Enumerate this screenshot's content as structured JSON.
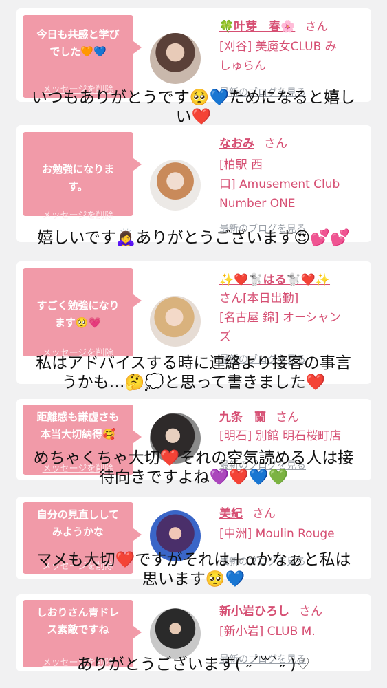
{
  "delete_label": "メッセージを削除",
  "blog_label": "最新のブログを見る",
  "honorific": "さん",
  "cards": [
    {
      "message": "今日も共感と学び\nでした🧡💙",
      "name": "🍀叶芽　春🌸",
      "shop": "[刈谷] 美魔女CLUB み\nしゅらん"
    },
    {
      "message": "お勉強になりま\nす。",
      "name": "なおみ",
      "shop": "[柏駅 西\n口] Amusement Club\nNumber ONE"
    },
    {
      "message": "すごく勉強になり\nます🥺💗",
      "name": "✨❤️🐩はる🐩❤️✨",
      "shop": "さん[本日出勤]\n[名古屋 錦] オーシャン\nズ"
    },
    {
      "message": "距離感も謙虚さも\n本当大切納得🥰",
      "name": "九条　蘭",
      "shop": "[明石] 別館 明石桜町店"
    },
    {
      "message": "自分の見直しして\nみようかな",
      "name": "美紀",
      "shop": "[中洲] Moulin Rouge"
    },
    {
      "message": "しおりさん青ドレ\nス素敵ですね",
      "name": "新小岩ひろし",
      "shop": "[新小岩] CLUB M."
    }
  ],
  "overlays": [
    "いつもありがとうです🥺💙ためになると嬉し\nい❤️",
    "嬉しいです🙇‍♀️ありがとうございます😍💕💕",
    "私はアドバイスする時に連絡より接客の事言\nうかも…🤔💭と思って書きました❤️",
    "めちゃくちゃ大切❤️それの空気読める人は接\n待向きですよね💜❤️💙💚",
    "マメも大切❤️ですがそれは＋αかなぁと私は\n思います🥺💙",
    "ありがとうございます( ˶´꒳`˶ )♡"
  ]
}
